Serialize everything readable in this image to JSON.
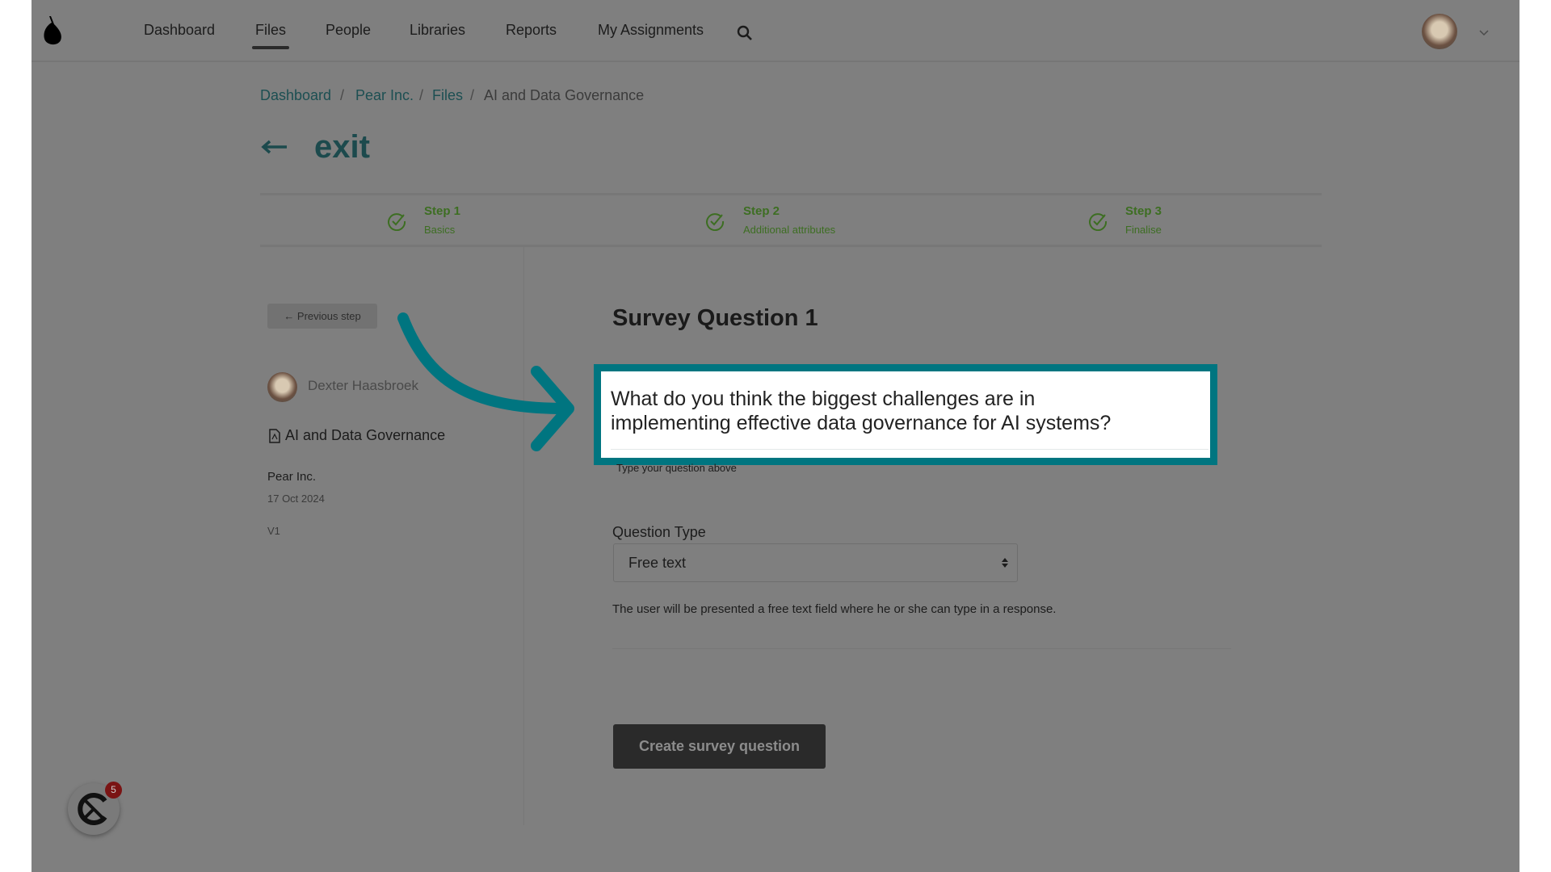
{
  "nav": {
    "items": [
      "Dashboard",
      "Files",
      "People",
      "Libraries",
      "Reports",
      "My Assignments"
    ],
    "active": "Files",
    "logo_icon": "pear-logo-icon",
    "search_icon": "search-icon"
  },
  "breadcrumb": [
    "Dashboard",
    "Pear Inc.",
    "Files",
    "AI and Data Governance"
  ],
  "header": {
    "back_label": "exit"
  },
  "steps": [
    {
      "title": "Step 1",
      "subtitle": "Basics",
      "complete": true
    },
    {
      "title": "Step 2",
      "subtitle": "Additional attributes",
      "complete": true
    },
    {
      "title": "Step 3",
      "subtitle": "Finalise",
      "complete": true
    }
  ],
  "sidebar": {
    "previous_step": "← Previous step",
    "author": "Dexter Haasbroek",
    "file_name": "AI and Data Governance",
    "company": "Pear Inc.",
    "date": "17 Oct 2024",
    "version": "V1"
  },
  "form": {
    "title": "Survey Question 1",
    "question_value": "What do you think the biggest challenges are in implementing effective data governance for AI systems?",
    "question_line1": "What do you think the biggest challenges are in",
    "question_line2": "implementing effective data governance for AI systems?",
    "question_hint": "Type your question above",
    "type_label": "Question Type",
    "type_value": "Free text",
    "type_description": "The user will be presented a free text field where he or she can type in a response.",
    "submit_label": "Create survey question"
  },
  "chat_widget": {
    "badge_count": "5"
  },
  "colors": {
    "highlight": "#007580",
    "overlay": "#7f7f7f",
    "step_complete": "#3d6e22"
  }
}
